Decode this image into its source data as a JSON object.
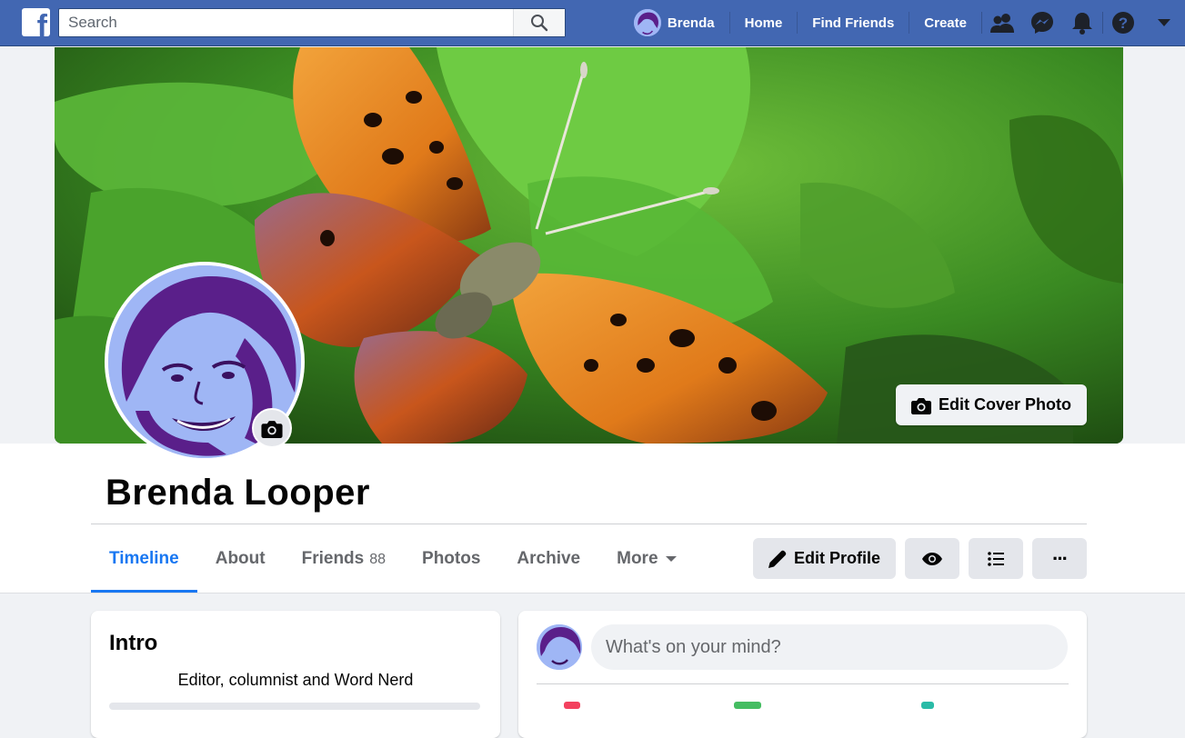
{
  "topbar": {
    "logo_letter": "f",
    "search_placeholder": "Search",
    "user_name": "Brenda",
    "nav": [
      "Home",
      "Find Friends",
      "Create"
    ],
    "icons": [
      "friends-icon",
      "messenger-icon",
      "notifications-icon",
      "help-icon",
      "account-menu-icon"
    ]
  },
  "cover": {
    "edit_label": "Edit Cover Photo"
  },
  "profile": {
    "name": "Brenda Looper"
  },
  "tabs": [
    {
      "label": "Timeline",
      "active": true
    },
    {
      "label": "About"
    },
    {
      "label": "Friends",
      "count": "88"
    },
    {
      "label": "Photos"
    },
    {
      "label": "Archive"
    },
    {
      "label": "More"
    }
  ],
  "actions": {
    "edit_profile": "Edit Profile",
    "more_dots": "···"
  },
  "intro": {
    "title": "Intro",
    "bio": "Editor, columnist and Word Nerd"
  },
  "composer": {
    "placeholder": "What's on your mind?"
  },
  "colors": {
    "topbar": "#4267b2",
    "accent": "#1877f2",
    "avatar_bg": "#9fb6f5",
    "avatar_ink": "#5a1f8a"
  }
}
